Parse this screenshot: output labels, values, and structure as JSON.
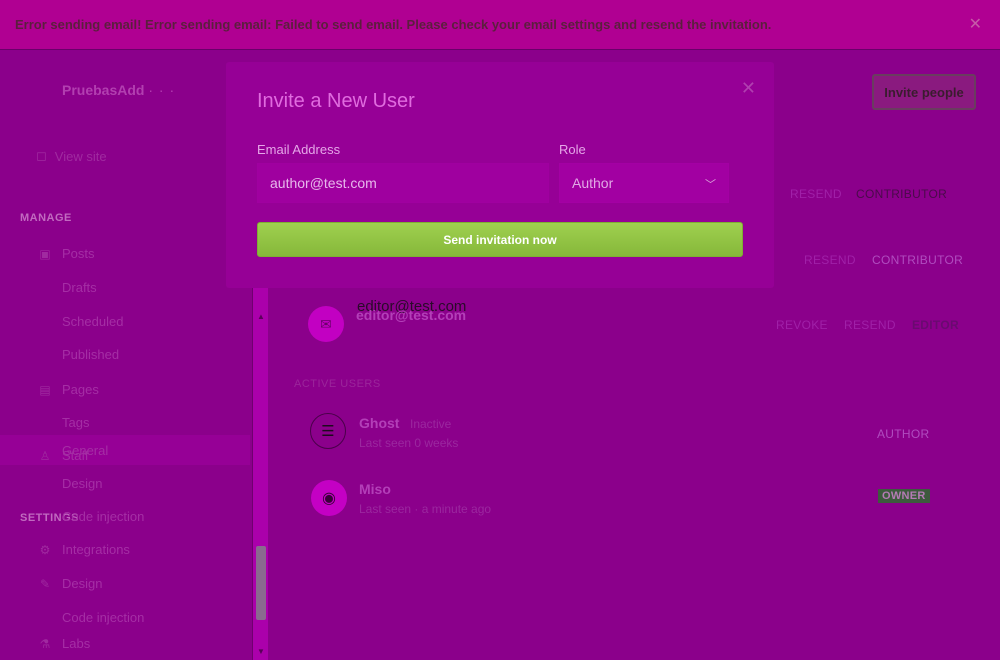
{
  "banner": {
    "message": "Error sending email! Error sending email: Failed to send email. Please check your email settings and resend the invitation.",
    "close": "✕"
  },
  "sidebar": {
    "brand": "PruebasAdd",
    "brand_suffix": "· · ·",
    "view_site": "View site",
    "manage_label": "MANAGE",
    "settings_label": "SETTINGS",
    "items": {
      "posts": "Posts",
      "drafts": "Drafts",
      "scheduled": "Scheduled",
      "published": "Published",
      "pages": "Pages",
      "tags": "Tags",
      "staff": "Staff",
      "general": "General",
      "design": "Design",
      "code_injection": "Code injection",
      "integrations": "Integrations",
      "labs": "Labs"
    }
  },
  "main": {
    "invite_people": "Invite people",
    "resend": "RESEND",
    "revoke": "REVOKE",
    "contributor": "CONTRIBUTOR",
    "editor_role": "EDITOR",
    "author_role": "AUTHOR",
    "owner_badge": "OWNER",
    "invited_email": "editor@test.com",
    "active_users_label": "ACTIVE USERS",
    "users": [
      {
        "name": "Ghost",
        "tag": "Inactive",
        "sub": "Last seen 0 weeks"
      },
      {
        "name": "Miso",
        "sub": "Last seen · a minute ago"
      }
    ]
  },
  "modal": {
    "title": "Invite a New User",
    "email_label": "Email Address",
    "email_value": "author@test.com",
    "role_label": "Role",
    "role_value": "Author",
    "send_label": "Send invitation now",
    "close": "✕"
  },
  "colors": {
    "overlay": "#8b008b",
    "banner": "#b00092",
    "send_button": "#9fd04f"
  }
}
